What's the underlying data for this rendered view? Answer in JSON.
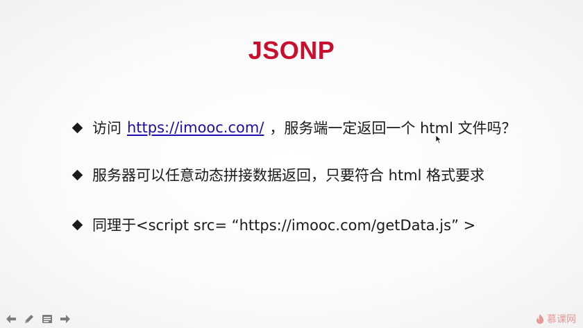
{
  "slide": {
    "title": "JSONP",
    "bullets": [
      {
        "before": "访问",
        "link": "https://imooc.com/",
        "after": "，服务端一定返回一个 html 文件吗？"
      },
      {
        "text": "服务器可以任意动态拼接数据返回，只要符合 html 格式要求"
      },
      {
        "text": "同理于<script src= “https://imooc.com/getData.js” >"
      }
    ]
  },
  "controls": {
    "icons": [
      "arrow-left-icon",
      "pen-icon",
      "menu-icon",
      "arrow-right-icon"
    ]
  },
  "watermark": {
    "text": "慕课网"
  },
  "colors": {
    "title": "#c8102e",
    "link": "#1a0dab",
    "text": "#1a1a1a",
    "watermark": "#e38a8a"
  }
}
